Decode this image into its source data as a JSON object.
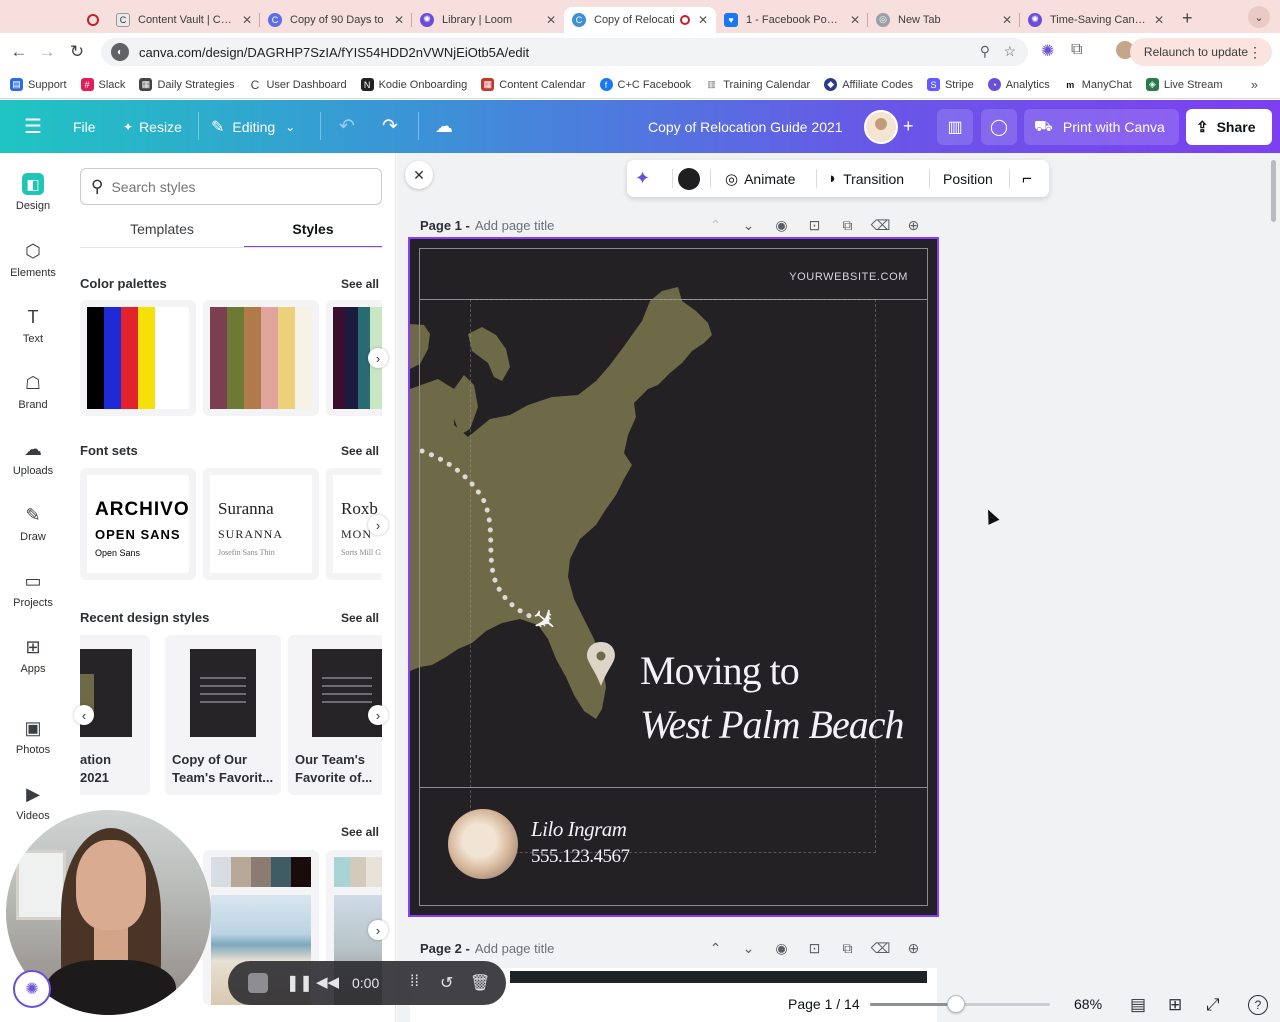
{
  "browser": {
    "tabs": [
      {
        "title": "Content Vault | Coffe",
        "color": "#e9e9e9"
      },
      {
        "title": "Copy of 90 Days to",
        "color": "#5b6ee8"
      },
      {
        "title": "Library | Loom",
        "color": "#6b4fd8"
      },
      {
        "title": "Copy of Relocati",
        "color": "#3e8fd8",
        "active": true
      },
      {
        "title": "1 - Facebook Post -",
        "color": "#1877f2"
      },
      {
        "title": "New Tab",
        "color": "#9aa0a6"
      },
      {
        "title": "Time-Saving Canva",
        "color": "#6b4fd8"
      }
    ],
    "url": "canva.com/design/DAGRHP7SzIA/fYIS54HDD2nVWNjEiOtb5A/edit",
    "relaunch_label": "Relaunch to update",
    "bookmarks": [
      {
        "label": "Support",
        "color": "#2d6cdf"
      },
      {
        "label": "Slack",
        "color": "#e01e5a"
      },
      {
        "label": "Daily Strategies",
        "color": "#444444"
      },
      {
        "label": "User Dashboard",
        "color": "#444444"
      },
      {
        "label": "Kodie Onboarding",
        "color": "#222222"
      },
      {
        "label": "Content Calendar",
        "color": "#c0392b"
      },
      {
        "label": "C+C Facebook",
        "color": "#1877f2"
      },
      {
        "label": "Training Calendar",
        "color": "#777777"
      },
      {
        "label": "Affiliate Codes",
        "color": "#2a3b8f"
      },
      {
        "label": "Stripe",
        "color": "#635bff"
      },
      {
        "label": "Analytics",
        "color": "#6b4fd8"
      },
      {
        "label": "ManyChat",
        "color": "#111111"
      },
      {
        "label": "Live Stream",
        "color": "#2b7a4b"
      }
    ]
  },
  "canva_header": {
    "file_label": "File",
    "resize_label": "Resize",
    "editing_label": "Editing",
    "doc_title": "Copy of Relocation Guide 2021",
    "print_label": "Print with Canva",
    "share_label": "Share"
  },
  "rail": [
    {
      "label": "Design",
      "icon": "design-icon",
      "glyph": "◧",
      "active": true
    },
    {
      "label": "Elements",
      "icon": "elements-icon",
      "glyph": "⬡"
    },
    {
      "label": "Text",
      "icon": "text-icon",
      "glyph": "T"
    },
    {
      "label": "Brand",
      "icon": "brand-icon",
      "glyph": "☖"
    },
    {
      "label": "Uploads",
      "icon": "uploads-icon",
      "glyph": "☁"
    },
    {
      "label": "Draw",
      "icon": "draw-icon",
      "glyph": "✎"
    },
    {
      "label": "Projects",
      "icon": "projects-icon",
      "glyph": "▭"
    },
    {
      "label": "Apps",
      "icon": "apps-icon",
      "glyph": "⊞"
    },
    {
      "label": "Photos",
      "icon": "photos-icon",
      "glyph": "▣"
    },
    {
      "label": "Videos",
      "icon": "videos-icon",
      "glyph": "▶"
    }
  ],
  "panel": {
    "search_placeholder": "Search styles",
    "tabs": [
      "Templates",
      "Styles"
    ],
    "see_all": "See all",
    "color_palettes_title": "Color palettes",
    "palettes": [
      [
        "#000000",
        "#1e2ad6",
        "#e3232b",
        "#f6e00a",
        "#ffffff",
        "#ffffff"
      ],
      [
        "#7c3f52",
        "#6d7a34",
        "#b07a4a",
        "#e0a59d",
        "#ecd17a",
        "#f6f2e5"
      ],
      [
        "#3a0f2d",
        "#1b1c3d",
        "#2a6b73",
        "#c9e6c4"
      ]
    ],
    "font_sets_title": "Font sets",
    "font_sets": [
      {
        "line1": "ARCHIVO",
        "line2": "OPEN SANS",
        "line3": "Open Sans"
      },
      {
        "line1": "Suranna",
        "line2": "SURANNA",
        "line3": "Josefin Sans Thin"
      },
      {
        "line1": "Roxb",
        "line2": "MON",
        "line3": "Sorts Mill G"
      }
    ],
    "recent_title": "Recent design styles",
    "recent": [
      {
        "line1": "ation",
        "line2": "2021"
      },
      {
        "line1": "Copy of Our",
        "line2": "Team's Favorit..."
      },
      {
        "line1": "Our Team's",
        "line2": "Favorite of..."
      }
    ],
    "fourth_section_suffix": "s"
  },
  "canvas": {
    "toolbar": {
      "animate_label": "Animate",
      "transition_label": "Transition",
      "position_label": "Position",
      "color": "#1f1e21"
    },
    "page1_label": "Page 1 -",
    "page2_label": "Page 2 -",
    "page_title_placeholder": "Add page title",
    "design": {
      "website": "YOURWEBSITE.COM",
      "headline_line1": "Moving to",
      "headline_line2": "West Palm Beach",
      "agent_name": "Lilo Ingram",
      "agent_phone": "555.123.4567",
      "map_color": "#6e6a47",
      "background": "#232124"
    }
  },
  "bottom": {
    "page_indicator": "Page 1 / 14",
    "zoom": "68%",
    "zoom_fraction": 0.48
  },
  "recorder": {
    "time": "0:00"
  }
}
